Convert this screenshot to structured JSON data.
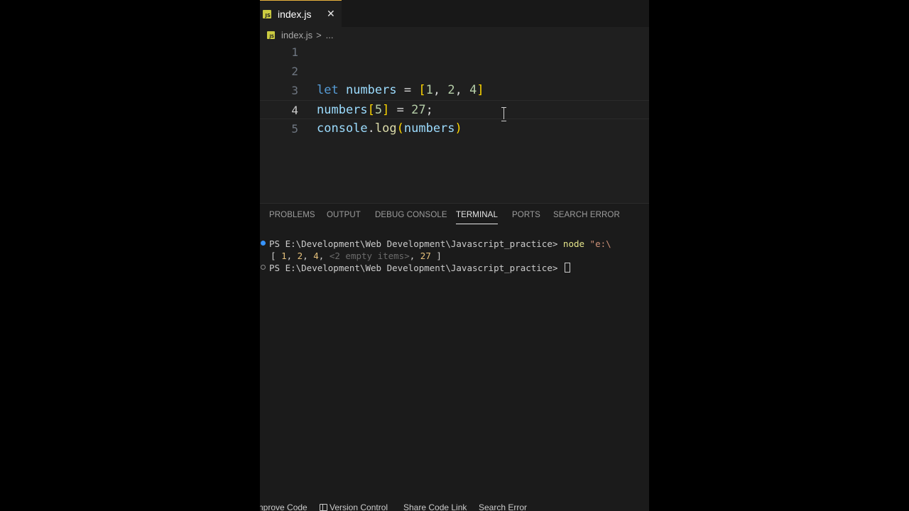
{
  "editor": {
    "tab": {
      "label": "index.js",
      "icon": "js-file-icon",
      "close_glyph": "✕"
    },
    "breadcrumb": {
      "file": "index.js",
      "separator": ">",
      "more": "..."
    },
    "line_numbers": [
      "1",
      "2",
      "3",
      "4",
      "5"
    ],
    "active_line": "4",
    "code_lines": [
      {
        "n": "1",
        "tokens": []
      },
      {
        "n": "2",
        "tokens": []
      },
      {
        "n": "3",
        "tokens": [
          {
            "t": "let",
            "c": "kw"
          },
          {
            "t": " ",
            "c": "op"
          },
          {
            "t": "numbers",
            "c": "var"
          },
          {
            "t": " = ",
            "c": "op"
          },
          {
            "t": "[",
            "c": "br"
          },
          {
            "t": "1",
            "c": "num"
          },
          {
            "t": ", ",
            "c": "op"
          },
          {
            "t": "2",
            "c": "num"
          },
          {
            "t": ", ",
            "c": "op"
          },
          {
            "t": "4",
            "c": "num"
          },
          {
            "t": "]",
            "c": "br"
          }
        ]
      },
      {
        "n": "4",
        "tokens": [
          {
            "t": "numbers",
            "c": "var"
          },
          {
            "t": "[",
            "c": "br"
          },
          {
            "t": "5",
            "c": "num"
          },
          {
            "t": "]",
            "c": "br"
          },
          {
            "t": " = ",
            "c": "op"
          },
          {
            "t": "27",
            "c": "num"
          },
          {
            "t": ";",
            "c": "op"
          }
        ]
      },
      {
        "n": "5",
        "tokens": [
          {
            "t": "console",
            "c": "var"
          },
          {
            "t": ".",
            "c": "op"
          },
          {
            "t": "log",
            "c": "fn"
          },
          {
            "t": "(",
            "c": "br"
          },
          {
            "t": "numbers",
            "c": "var"
          },
          {
            "t": ")",
            "c": "br"
          }
        ]
      }
    ]
  },
  "panel": {
    "tabs": [
      "PROBLEMS",
      "OUTPUT",
      "DEBUG CONSOLE",
      "TERMINAL",
      "PORTS",
      "SEARCH ERROR"
    ],
    "active_tab": "TERMINAL",
    "terminal": {
      "line1_prompt": "PS E:\\Development\\Web Development\\Javascript_practice> ",
      "line1_cmd": "node",
      "line1_arg": " \"e:\\",
      "output_open": "[ ",
      "output_vals": [
        "1",
        "2",
        "4"
      ],
      "output_empty": "<2 empty items>",
      "output_last": "27",
      "output_close": " ]",
      "line3_prompt": "PS E:\\Development\\Web Development\\Javascript_practice> "
    }
  },
  "status_bar": {
    "items": [
      "nprove Code",
      "Version Control",
      "Share Code Link",
      "Search Error"
    ]
  },
  "colors": {
    "editor_bg": "#1f1f1f",
    "keyword": "#569cd6",
    "variable": "#9cdcfe",
    "number": "#b5cea8",
    "bracket": "#ffd700",
    "function": "#dcdcaa",
    "accent_blue": "#3794ff"
  }
}
